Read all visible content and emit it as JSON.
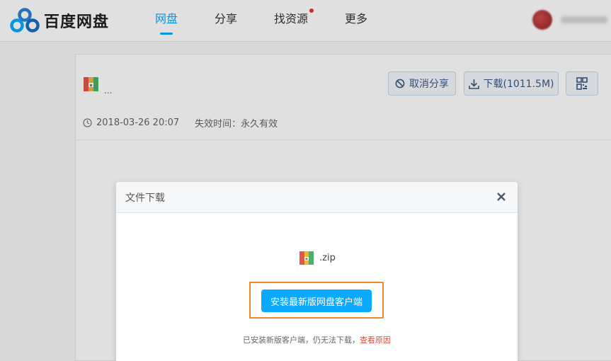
{
  "header": {
    "logo_text": "百度网盘",
    "nav": [
      {
        "label": "网盘",
        "active": true
      },
      {
        "label": "分享",
        "active": false
      },
      {
        "label": "找资源",
        "active": false,
        "badge": true
      },
      {
        "label": "更多",
        "active": false
      }
    ]
  },
  "share": {
    "file_name": "...",
    "cancel_label": "取消分享",
    "download_label": "下载(1011.5M)",
    "date": "2018-03-26 20:07",
    "expire_label": "失效时间：",
    "expire_value": "永久有效"
  },
  "modal": {
    "title": "文件下载",
    "file_name": ".zip",
    "install_label": "安装最新版网盘客户端",
    "hint": "已安装新版客户端，仍无法下载，",
    "hint_link": "查看原因"
  },
  "colors": {
    "accent": "#09aaff",
    "highlight": "#ef8b2c",
    "link_red": "#e0453a"
  },
  "icons": [
    "baidu-cloud-logo-icon",
    "file-zip-icon",
    "ban-icon",
    "download-icon",
    "qrcode-icon",
    "clock-icon",
    "close-icon"
  ]
}
